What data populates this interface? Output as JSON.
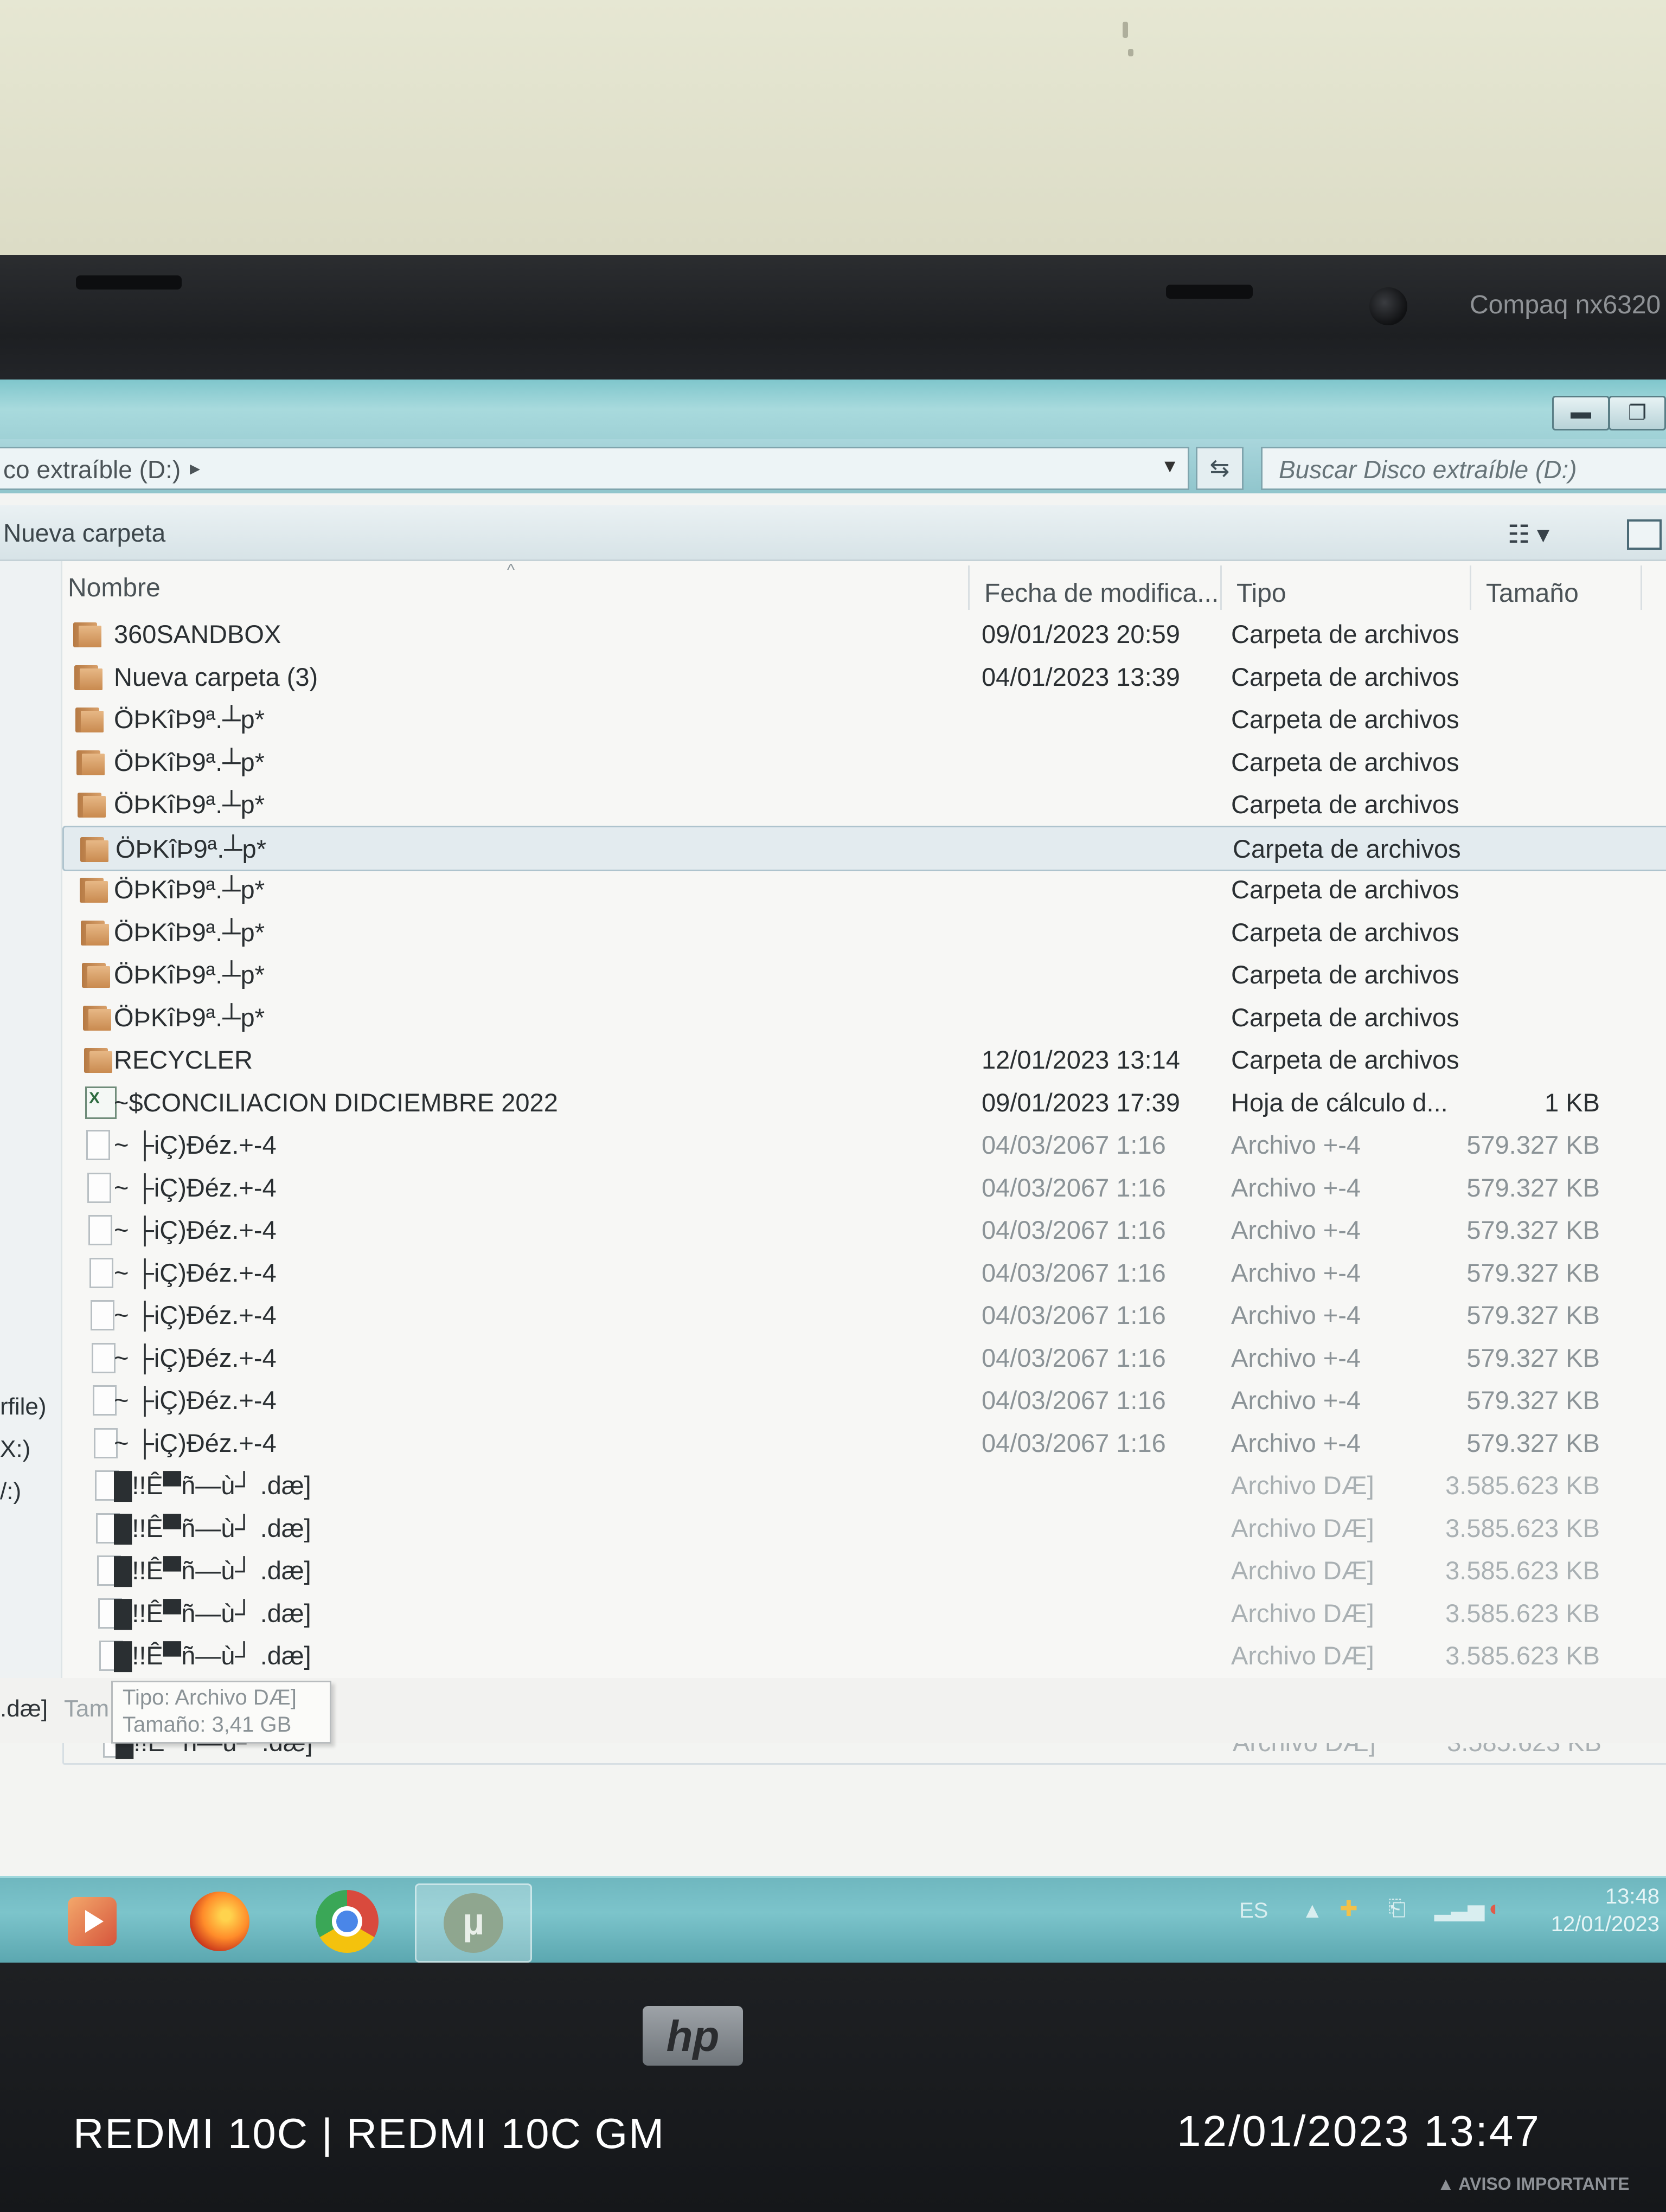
{
  "device": {
    "model": "Compaq nx6320",
    "brand_logo": "hp",
    "notice": "▲ AVISO IMPORTANTE"
  },
  "window": {
    "address_path": "co extraíble (D:)",
    "search_placeholder": "Buscar Disco extraíble (D:)",
    "toolbar": {
      "new_folder": "Nueva carpeta"
    }
  },
  "nav_pane": {
    "labels": [
      "rfile)",
      "X:)",
      "/:)"
    ]
  },
  "columns": {
    "name": "Nombre",
    "modified": "Fecha de modifica...",
    "type": "Tipo",
    "size": "Tamaño"
  },
  "files": [
    {
      "icon": "folder",
      "name": "360SANDBOX",
      "modified": "09/01/2023 20:59",
      "type": "Carpeta de archivos",
      "size": ""
    },
    {
      "icon": "folder",
      "name": "Nueva carpeta (3)",
      "modified": "04/01/2023 13:39",
      "type": "Carpeta de archivos",
      "size": ""
    },
    {
      "icon": "folder",
      "name": "ÖÞKîÞ9ª.┴p*",
      "modified": "",
      "type": "Carpeta de archivos",
      "size": ""
    },
    {
      "icon": "folder",
      "name": "ÖÞKîÞ9ª.┴p*",
      "modified": "",
      "type": "Carpeta de archivos",
      "size": ""
    },
    {
      "icon": "folder",
      "name": "ÖÞKîÞ9ª.┴p*",
      "modified": "",
      "type": "Carpeta de archivos",
      "size": ""
    },
    {
      "icon": "folder",
      "name": "ÖÞKîÞ9ª.┴p*",
      "modified": "",
      "type": "Carpeta de archivos",
      "size": ""
    },
    {
      "icon": "folder",
      "name": "ÖÞKîÞ9ª.┴p*",
      "modified": "",
      "type": "Carpeta de archivos",
      "size": ""
    },
    {
      "icon": "folder",
      "name": "ÖÞKîÞ9ª.┴p*",
      "modified": "",
      "type": "Carpeta de archivos",
      "size": ""
    },
    {
      "icon": "folder",
      "name": "ÖÞKîÞ9ª.┴p*",
      "modified": "",
      "type": "Carpeta de archivos",
      "size": ""
    },
    {
      "icon": "folder",
      "name": "ÖÞKîÞ9ª.┴p*",
      "modified": "",
      "type": "Carpeta de archivos",
      "size": ""
    },
    {
      "icon": "folder",
      "name": "RECYCLER",
      "modified": "12/01/2023 13:14",
      "type": "Carpeta de archivos",
      "size": ""
    },
    {
      "icon": "excel",
      "name": "~$CONCILIACION DIDCIEMBRE  2022",
      "modified": "09/01/2023 17:39",
      "type": "Hoja de cálculo d...",
      "size": "1 KB"
    },
    {
      "icon": "file",
      "name": "~ ├iÇ)Đéz.+-4",
      "modified": "04/03/2067 1:16",
      "type": "Archivo +-4",
      "size": "579.327 KB"
    },
    {
      "icon": "file",
      "name": "~ ├iÇ)Đéz.+-4",
      "modified": "04/03/2067 1:16",
      "type": "Archivo +-4",
      "size": "579.327 KB"
    },
    {
      "icon": "file",
      "name": "~ ├iÇ)Đéz.+-4",
      "modified": "04/03/2067 1:16",
      "type": "Archivo +-4",
      "size": "579.327 KB"
    },
    {
      "icon": "file",
      "name": "~ ├iÇ)Đéz.+-4",
      "modified": "04/03/2067 1:16",
      "type": "Archivo +-4",
      "size": "579.327 KB"
    },
    {
      "icon": "file",
      "name": "~ ├iÇ)Đéz.+-4",
      "modified": "04/03/2067 1:16",
      "type": "Archivo +-4",
      "size": "579.327 KB"
    },
    {
      "icon": "file",
      "name": "~ ├iÇ)Đéz.+-4",
      "modified": "04/03/2067 1:16",
      "type": "Archivo +-4",
      "size": "579.327 KB"
    },
    {
      "icon": "file",
      "name": "~ ├iÇ)Đéz.+-4",
      "modified": "04/03/2067 1:16",
      "type": "Archivo +-4",
      "size": "579.327 KB"
    },
    {
      "icon": "file",
      "name": "~ ├iÇ)Đéz.+-4",
      "modified": "04/03/2067 1:16",
      "type": "Archivo +-4",
      "size": "579.327 KB"
    },
    {
      "icon": "file",
      "name": "█!!Ê▀ñ—ù┘ .dæ]",
      "modified": "",
      "type": "Archivo DÆ]",
      "size": "3.585.623 KB"
    },
    {
      "icon": "file",
      "name": "█!!Ê▀ñ—ù┘ .dæ]",
      "modified": "",
      "type": "Archivo DÆ]",
      "size": "3.585.623 KB"
    },
    {
      "icon": "file",
      "name": "█!!Ê▀ñ—ù┘ .dæ]",
      "modified": "",
      "type": "Archivo DÆ]",
      "size": "3.585.623 KB"
    },
    {
      "icon": "file",
      "name": "█!!Ê▀ñ—ù┘ .dæ]",
      "modified": "",
      "type": "Archivo DÆ]",
      "size": "3.585.623 KB"
    },
    {
      "icon": "file",
      "name": "█!!Ê▀ñ—ù┘ .dæ]",
      "modified": "",
      "type": "Archivo DÆ]",
      "size": "3.585.623 KB"
    },
    {
      "icon": "file",
      "name": "█!!Ê▀ñ—ù┘ .dæ]",
      "modified": "",
      "type": "Archivo DÆ]",
      "size": "3.585.623 KB"
    },
    {
      "icon": "file",
      "name": "█!!Ê▀ñ—ù┘ .dæ]",
      "modified": "",
      "type": "Archivo DÆ]",
      "size": "3.585.623 KB"
    }
  ],
  "selected_row": 5,
  "hover_row": 26,
  "status_bar": {
    "left_text": ".dæ]",
    "size_label": "Tam"
  },
  "tooltip": {
    "type": "Tipo: Archivo DÆ]",
    "size": "Tamaño: 3,41 GB"
  },
  "taskbar": {
    "apps": [
      "media-player-icon",
      "firefox-icon",
      "chrome-icon",
      "utorrent-icon"
    ],
    "language": "ES",
    "clock_time": "13:48",
    "clock_date": "12/01/2023"
  },
  "phone_watermark": {
    "model": "REDMI 10C | REDMI 10C GM",
    "datetime": "12/01/2023  13:47"
  },
  "colors": {
    "taskbar": "#6fb7bf",
    "selection": "#e3ebef",
    "folder": "#d8a06a"
  }
}
